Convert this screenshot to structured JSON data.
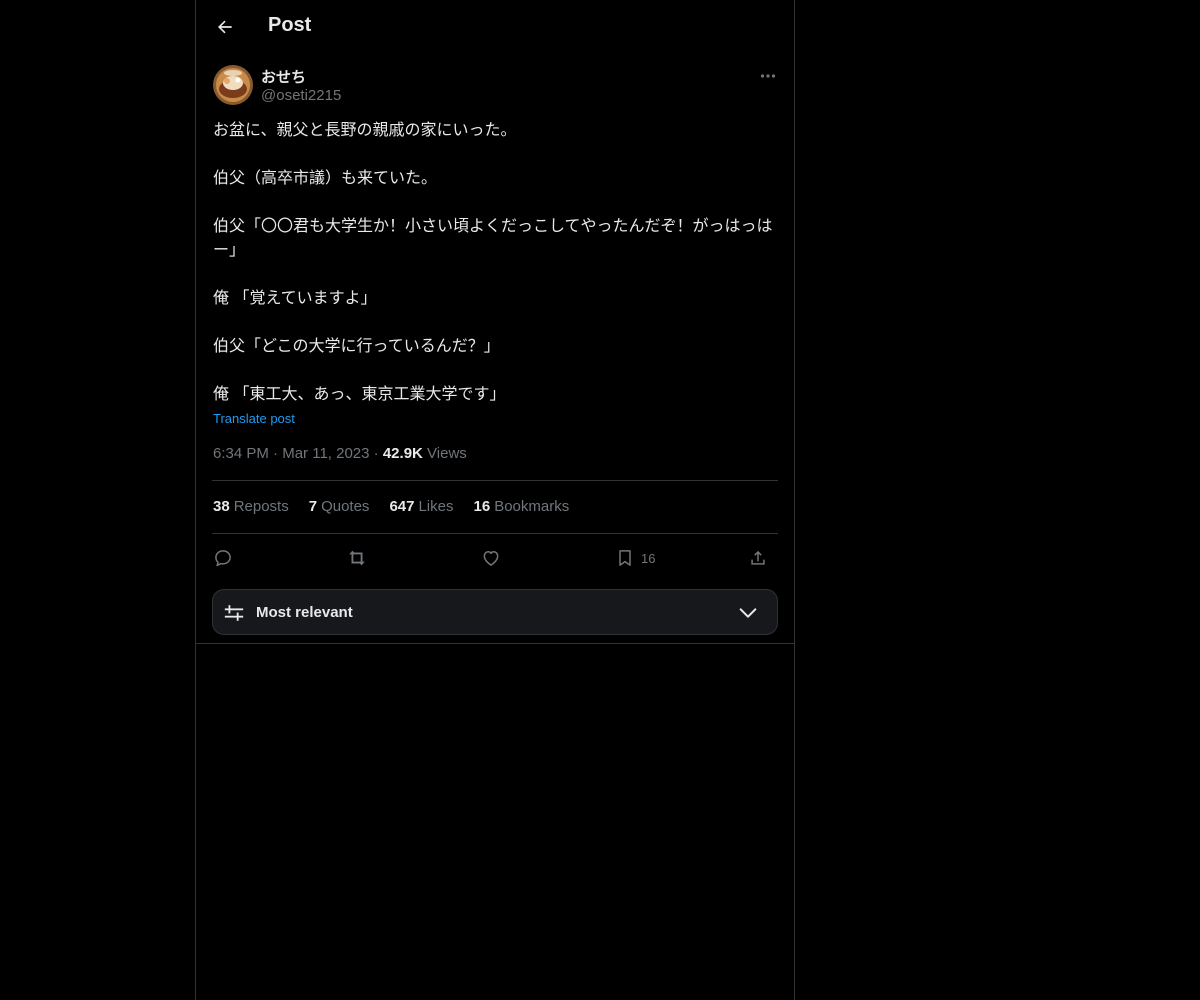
{
  "header": {
    "title": "Post",
    "back_icon": "arrow-left-icon"
  },
  "author": {
    "display_name": "おせち",
    "handle": "@oseti2215"
  },
  "post": {
    "paragraphs": [
      "お盆に、親父と長野の親戚の家にいった。",
      "伯父（高卒市議）も来ていた。",
      "伯父「〇〇君も大学生か！小さい頃よくだっこしてやったんだぞ！がっはっはー」",
      "俺 「覚えていますよ」",
      "伯父「どこの大学に行っているんだ？」",
      "俺 「東工大、あっ、東京工業大学です」"
    ],
    "translate_label": "Translate post"
  },
  "meta": {
    "time": "6:34 PM",
    "sep": "·",
    "date": "Mar 11, 2023",
    "views_count": "42.9K",
    "views_label": "Views"
  },
  "stats": {
    "reposts_count": "38",
    "reposts_label": "Reposts",
    "quotes_count": "7",
    "quotes_label": "Quotes",
    "likes_count": "647",
    "likes_label": "Likes",
    "bookmarks_count": "16",
    "bookmarks_label": "Bookmarks"
  },
  "actions": {
    "bookmark_count": "16"
  },
  "sort": {
    "label": "Most relevant"
  },
  "colors": {
    "background": "#000000",
    "text": "#e7e9ea",
    "secondary": "#71767b",
    "link": "#1d9bf0",
    "border": "#2f3336"
  }
}
